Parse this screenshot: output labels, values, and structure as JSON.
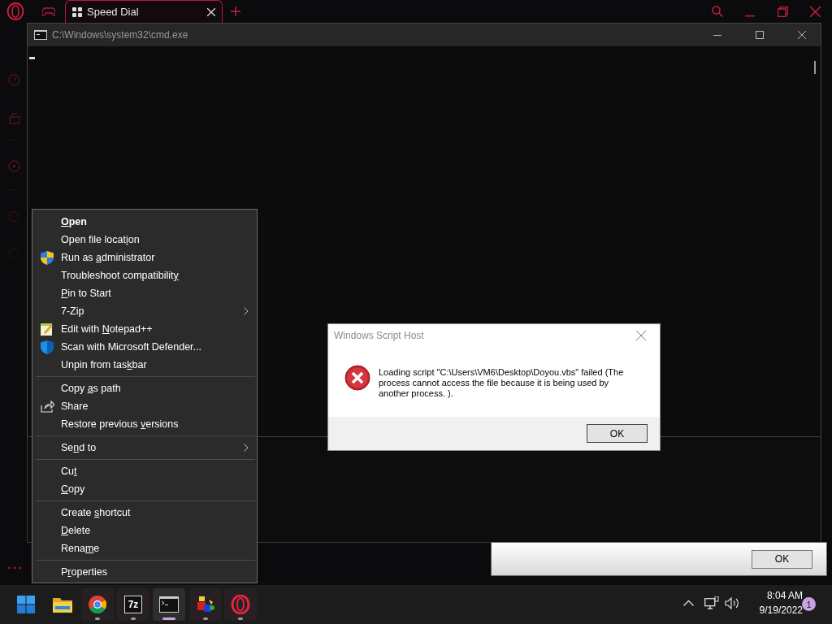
{
  "browser": {
    "tabs": [
      {
        "title": "Speed Dial",
        "selected": true
      }
    ]
  },
  "cmd_window": {
    "title": "C:\\Windows\\system32\\cmd.exe"
  },
  "context_menu": {
    "groups": [
      {
        "items": [
          {
            "kind": "plain",
            "key": "O",
            "after": "pen",
            "bold": true,
            "submenu": false
          },
          {
            "kind": "plain",
            "before": "Open file locat",
            "key": "i",
            "after": "on",
            "bold": false,
            "submenu": false
          },
          {
            "kind": "shield",
            "before": "Run as ",
            "key": "a",
            "after": "dministrator",
            "bold": false,
            "submenu": false
          },
          {
            "kind": "plain",
            "before": "Troubleshoot compatibilit",
            "key": "y",
            "bold": false,
            "submenu": false
          },
          {
            "kind": "plain",
            "key": "P",
            "after": "in to Start",
            "bold": false,
            "submenu": false
          },
          {
            "kind": "plain",
            "before": "7-Zip",
            "bold": false,
            "submenu": true
          },
          {
            "kind": "notepad",
            "before": "Edit with ",
            "key": "N",
            "after": "otepad++",
            "bold": false,
            "submenu": false
          },
          {
            "kind": "defender",
            "before": "Scan with Microsoft Defender...",
            "bold": false,
            "submenu": false
          },
          {
            "kind": "plain",
            "before": "Unpin from tas",
            "key": "k",
            "after": "bar",
            "bold": false,
            "submenu": false
          }
        ]
      },
      {
        "items": [
          {
            "kind": "plain",
            "before": "Copy ",
            "key": "a",
            "after": "s path",
            "bold": false,
            "submenu": false
          },
          {
            "kind": "share",
            "before": "Share",
            "bold": false,
            "submenu": false
          },
          {
            "kind": "plain",
            "before": "Restore previous ",
            "key": "v",
            "after": "ersions",
            "bold": false,
            "submenu": false
          }
        ]
      },
      {
        "items": [
          {
            "kind": "plain",
            "before": "Se",
            "key": "n",
            "after": "d to",
            "bold": false,
            "submenu": true
          }
        ]
      },
      {
        "items": [
          {
            "kind": "plain",
            "before": "Cu",
            "key": "t",
            "bold": false,
            "submenu": false
          },
          {
            "kind": "plain",
            "key": "C",
            "after": "opy",
            "bold": false,
            "submenu": false
          }
        ]
      },
      {
        "items": [
          {
            "kind": "plain",
            "before": "Create ",
            "key": "s",
            "after": "hortcut",
            "bold": false,
            "submenu": false
          },
          {
            "kind": "plain",
            "key": "D",
            "after": "elete",
            "bold": false,
            "submenu": false
          },
          {
            "kind": "plain",
            "before": "Rena",
            "key": "m",
            "after": "e",
            "bold": false,
            "submenu": false
          }
        ]
      },
      {
        "items": [
          {
            "kind": "plain",
            "before": "P",
            "key": "r",
            "after": "operties",
            "bold": false,
            "submenu": false
          }
        ]
      }
    ]
  },
  "script_host_dialog": {
    "title": "Windows Script Host",
    "message": "Loading script \"C:\\Users\\VM6\\Desktop\\Doyou.vbs\" failed (The process cannot access the file because it is being used by another process. ).",
    "button": "OK"
  },
  "background_dialog": {
    "button": "OK"
  },
  "taskbar": {
    "apps": [
      {
        "kind": "start",
        "running": false,
        "active": false
      },
      {
        "kind": "explorer",
        "running": false,
        "active": false
      },
      {
        "kind": "chrome",
        "running": true,
        "active": false
      },
      {
        "kind": "sevenzip",
        "label": "7z",
        "running": true,
        "active": false
      },
      {
        "kind": "cmd",
        "running": true,
        "active": true
      },
      {
        "kind": "cubes",
        "running": true,
        "active": false
      },
      {
        "kind": "opera",
        "running": true,
        "active": false
      }
    ],
    "clock": {
      "time": "8:04 AM",
      "date": "9/19/2022"
    },
    "notification_count": "1"
  }
}
